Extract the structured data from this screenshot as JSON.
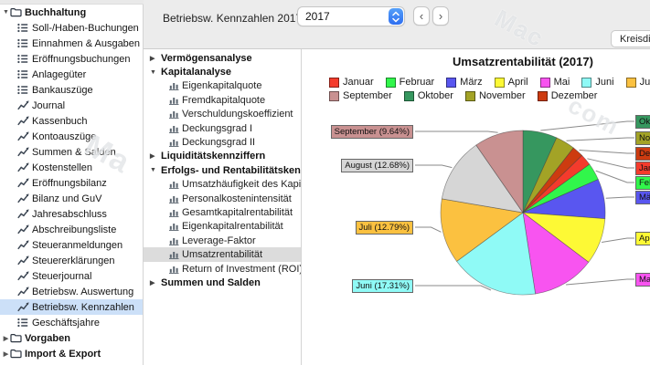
{
  "toolbar": {
    "context_title": "Betriebsw. Kennzahlen 2017",
    "year_select": {
      "value": "2017"
    },
    "prev_label": "‹",
    "next_label": "›",
    "chart_type_button": "Kreisdiagramm"
  },
  "sidebar": {
    "items": [
      {
        "label": "Buchhaltung",
        "icon": "folder",
        "bold": true,
        "disclosure": "expanded",
        "selected": false
      },
      {
        "label": "Soll-/Haben-Buchungen",
        "icon": "list",
        "bold": false,
        "selected": false
      },
      {
        "label": "Einnahmen & Ausgaben",
        "icon": "list",
        "bold": false,
        "selected": false
      },
      {
        "label": "Eröffnungsbuchungen",
        "icon": "list",
        "bold": false,
        "selected": false
      },
      {
        "label": "Anlagegüter",
        "icon": "list",
        "bold": false,
        "selected": false
      },
      {
        "label": "Bankauszüge",
        "icon": "list",
        "bold": false,
        "selected": false
      },
      {
        "label": "Journal",
        "icon": "chart",
        "bold": false,
        "selected": false
      },
      {
        "label": "Kassenbuch",
        "icon": "chart",
        "bold": false,
        "selected": false
      },
      {
        "label": "Kontoauszüge",
        "icon": "chart",
        "bold": false,
        "selected": false
      },
      {
        "label": "Summen & Salden",
        "icon": "chart",
        "bold": false,
        "selected": false
      },
      {
        "label": "Kostenstellen",
        "icon": "chart",
        "bold": false,
        "selected": false
      },
      {
        "label": "Eröffnungsbilanz",
        "icon": "chart",
        "bold": false,
        "selected": false
      },
      {
        "label": "Bilanz und GuV",
        "icon": "chart",
        "bold": false,
        "selected": false
      },
      {
        "label": "Jahresabschluss",
        "icon": "chart",
        "bold": false,
        "selected": false
      },
      {
        "label": "Abschreibungsliste",
        "icon": "chart",
        "bold": false,
        "selected": false
      },
      {
        "label": "Steueranmeldungen",
        "icon": "chart",
        "bold": false,
        "selected": false
      },
      {
        "label": "Steuererklärungen",
        "icon": "chart",
        "bold": false,
        "selected": false
      },
      {
        "label": "Steuerjournal",
        "icon": "chart",
        "bold": false,
        "selected": false
      },
      {
        "label": "Betriebsw. Auswertung",
        "icon": "chart",
        "bold": false,
        "selected": false
      },
      {
        "label": "Betriebsw. Kennzahlen",
        "icon": "chart",
        "bold": false,
        "selected": true
      },
      {
        "label": "Geschäftsjahre",
        "icon": "list",
        "bold": false,
        "selected": false
      },
      {
        "label": "Vorgaben",
        "icon": "folder",
        "bold": true,
        "disclosure": "collapsed",
        "selected": false
      },
      {
        "label": "Import & Export",
        "icon": "folder",
        "bold": true,
        "disclosure": "collapsed",
        "selected": false
      }
    ]
  },
  "tree": {
    "items": [
      {
        "label": "Vermögensanalyse",
        "type": "group",
        "expanded": false
      },
      {
        "label": "Kapitalanalyse",
        "type": "group",
        "expanded": true
      },
      {
        "label": "Eigenkapitalquote",
        "type": "item",
        "selected": false
      },
      {
        "label": "Fremdkapitalquote",
        "type": "item",
        "selected": false
      },
      {
        "label": "Verschuldungskoeffizient",
        "type": "item",
        "selected": false
      },
      {
        "label": "Deckungsgrad I",
        "type": "item",
        "selected": false
      },
      {
        "label": "Deckungsgrad II",
        "type": "item",
        "selected": false
      },
      {
        "label": "Liquiditätskennziffern",
        "type": "group",
        "expanded": false
      },
      {
        "label": "Erfolgs- und Rentabilitätskennz...",
        "type": "group",
        "expanded": true
      },
      {
        "label": "Umsatzhäufigkeit des Kapitals",
        "type": "item",
        "selected": false
      },
      {
        "label": "Personalkostenintensität",
        "type": "item",
        "selected": false
      },
      {
        "label": "Gesamtkapitalrentabilität",
        "type": "item",
        "selected": false
      },
      {
        "label": "Eigenkapitalrentabilität",
        "type": "item",
        "selected": false
      },
      {
        "label": "Leverage-Faktor",
        "type": "item",
        "selected": false
      },
      {
        "label": "Umsatzrentabilität",
        "type": "item",
        "selected": true
      },
      {
        "label": "Return of Investment (ROI)",
        "type": "item",
        "selected": false
      },
      {
        "label": "Summen und Salden",
        "type": "group",
        "expanded": false
      }
    ]
  },
  "chart_data": {
    "type": "pie",
    "title": "Umsatzrentabilität (2017)",
    "unit": "%",
    "start_month_index": 9,
    "legend_rows": [
      [
        0,
        1,
        2,
        3,
        4,
        5,
        6,
        7
      ],
      [
        8,
        9,
        10,
        11
      ]
    ],
    "slices": [
      {
        "label": "Januar",
        "value": 2.24,
        "color": "#f43b2c"
      },
      {
        "label": "Februar",
        "value": 3.38,
        "color": "#31f64b"
      },
      {
        "label": "März",
        "value": 7.81,
        "color": "#5956f0"
      },
      {
        "label": "April",
        "value": 9.12,
        "color": "#fdf935"
      },
      {
        "label": "Mai",
        "value": 12.28,
        "color": "#f854f0"
      },
      {
        "label": "Juni",
        "value": 17.31,
        "color": "#8ffaf6"
      },
      {
        "label": "Juli",
        "value": 12.79,
        "color": "#fbc140"
      },
      {
        "label": "August",
        "value": 12.68,
        "color": "#d6d6d6"
      },
      {
        "label": "September",
        "value": 9.64,
        "color": "#c99191"
      },
      {
        "label": "Oktober",
        "value": 6.73,
        "color": "#36975f"
      },
      {
        "label": "November",
        "value": 3.81,
        "color": "#a3a326"
      },
      {
        "label": "Dezember",
        "value": 2.21,
        "color": "#cd3b10"
      }
    ],
    "visible_percent_labels": {
      "Juni": "17.31%",
      "Juli": "12.79%",
      "August": "12.68%",
      "September": "9.64%"
    }
  },
  "colors": {
    "toolbar_bg": "#ececec",
    "sidebar_selection": "#cce0f8",
    "tree_selection": "#dcdcdc",
    "accent_blue": "#3b7df7"
  },
  "watermark": {
    "fragments": [
      "Mac",
      "com",
      "Ma"
    ]
  }
}
